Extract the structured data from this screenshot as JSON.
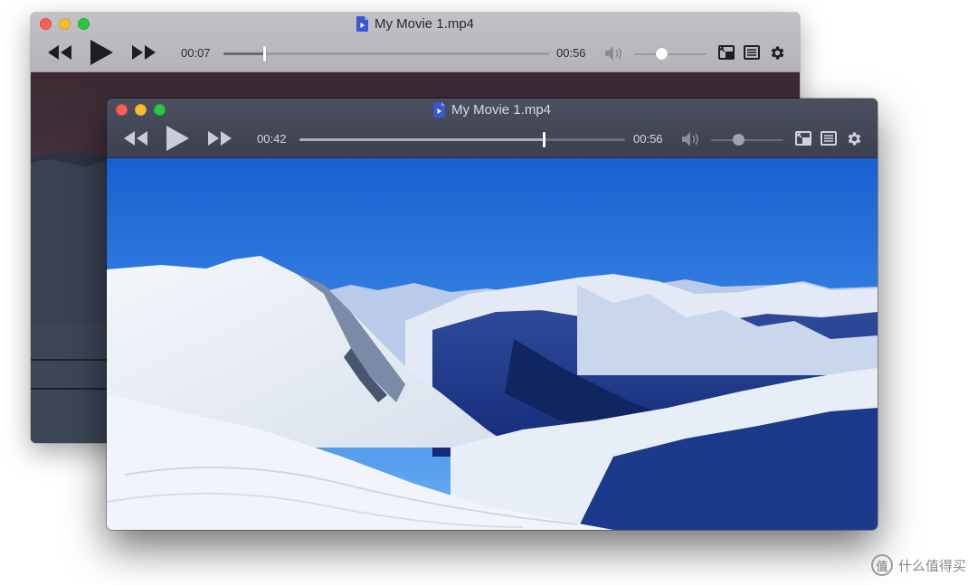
{
  "back_window": {
    "title": "My Movie 1.mp4",
    "current_time": "00:07",
    "duration": "00:56",
    "progress": 0.125,
    "volume": 0.38
  },
  "front_window": {
    "title": "My Movie 1.mp4",
    "current_time": "00:42",
    "duration": "00:56",
    "progress": 0.75,
    "volume": 0.38
  },
  "icons": {
    "rewind": "rewind-icon",
    "play": "play-icon",
    "fast_forward": "fast-forward-icon",
    "volume": "speaker-icon",
    "pip": "picture-in-picture-icon",
    "playlist": "playlist-icon",
    "settings": "gear-icon",
    "file": "video-file-icon"
  },
  "colors": {
    "traffic_red": "#fc5f57",
    "traffic_yellow": "#fdbc2e",
    "traffic_green": "#28c840",
    "file_icon": "#3a58d6"
  },
  "watermark": {
    "logo": "值",
    "text": "什么值得买"
  }
}
